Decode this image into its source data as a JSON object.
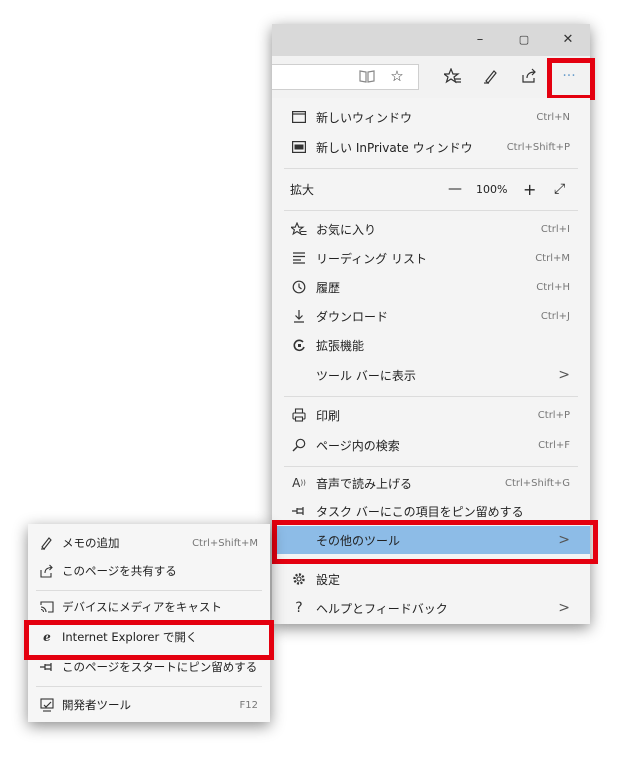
{
  "window_controls": {
    "minimize": "–",
    "maximize": "▢",
    "close": "✕"
  },
  "toolbar": {
    "more_button": "···"
  },
  "menu": {
    "items": [
      {
        "icon": "new-window-icon",
        "label": "新しいウィンドウ",
        "shortcut": "Ctrl+N"
      },
      {
        "icon": "inprivate-window-icon",
        "label": "新しい InPrivate ウィンドウ",
        "shortcut": "Ctrl+Shift+P"
      },
      {
        "icon": "zoom-icon",
        "label": "拡大"
      },
      {
        "icon": "favorites-icon",
        "label": "お気に入り",
        "shortcut": "Ctrl+I"
      },
      {
        "icon": "reading-list-icon",
        "label": "リーディング リスト",
        "shortcut": "Ctrl+M"
      },
      {
        "icon": "history-icon",
        "label": "履歴",
        "shortcut": "Ctrl+H"
      },
      {
        "icon": "download-icon",
        "label": "ダウンロード",
        "shortcut": "Ctrl+J"
      },
      {
        "icon": "extensions-icon",
        "label": "拡張機能"
      },
      {
        "icon": "none",
        "label": "ツール バーに表示",
        "arrow": ">"
      },
      {
        "icon": "print-icon",
        "label": "印刷",
        "shortcut": "Ctrl+P"
      },
      {
        "icon": "find-icon",
        "label": "ページ内の検索",
        "shortcut": "Ctrl+F"
      },
      {
        "icon": "read-aloud-icon",
        "label": "音声で読み上げる",
        "shortcut": "Ctrl+Shift+G"
      },
      {
        "icon": "pin-taskbar-icon",
        "label": "タスク バーにこの項目をピン留めする"
      },
      {
        "icon": "none",
        "label": "その他のツール",
        "arrow": ">"
      },
      {
        "icon": "settings-icon",
        "label": "設定"
      },
      {
        "icon": "help-icon",
        "label": "ヘルプとフィードバック",
        "arrow": ">"
      }
    ],
    "zoom": {
      "minus": "—",
      "value": "100%",
      "plus": "+",
      "fullscreen": "⤢"
    }
  },
  "submenu": {
    "items": [
      {
        "icon": "pen-icon",
        "label": "メモの追加",
        "shortcut": "Ctrl+Shift+M"
      },
      {
        "icon": "share-icon",
        "label": "このページを共有する"
      },
      {
        "icon": "cast-icon",
        "label": "デバイスにメディアをキャスト"
      },
      {
        "icon": "ie-icon",
        "label": "Internet Explorer で開く"
      },
      {
        "icon": "pin-icon",
        "label": "このページをスタートにピン留めする"
      },
      {
        "icon": "devtools-icon",
        "label": "開発者ツール",
        "shortcut": "F12"
      }
    ]
  },
  "colors": {
    "highlight_box": "#e4000f",
    "active_item": "#8dbce7"
  }
}
